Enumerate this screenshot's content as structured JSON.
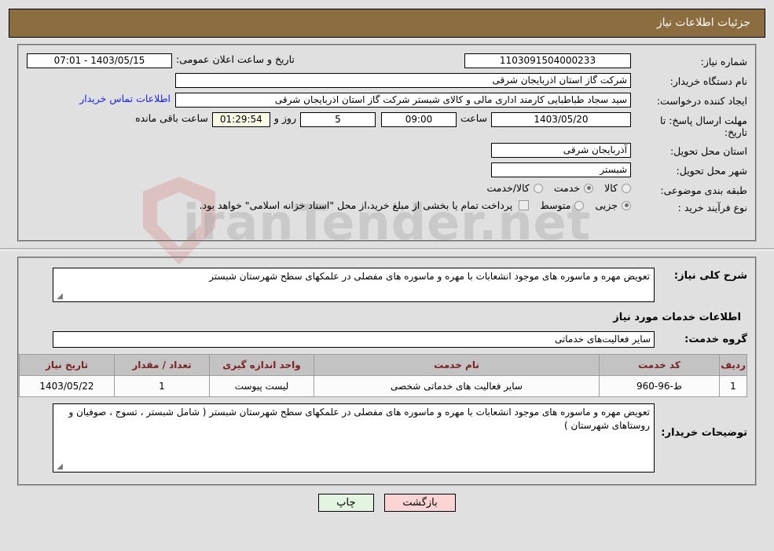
{
  "header": {
    "title": "جزئیات اطلاعات نیاز"
  },
  "form": {
    "need_number_label": "شماره نیاز:",
    "need_number_value": "1103091504000233",
    "announce_label": "تاریخ و ساعت اعلان عمومی:",
    "announce_value": "1403/05/15 - 07:01",
    "buyer_org_label": "نام دستگاه خریدار:",
    "buyer_org_value": "شرکت گاز استان اذربایجان شرقی",
    "requester_label": "ایجاد کننده درخواست:",
    "requester_value": "سید سجاد  طباطبایی کارمند اداری مالی و کالای شبستر  شرکت گاز استان اذربایجان شرقی",
    "contact_link": "اطلاعات تماس خریدار",
    "deadline_label": "مهلت ارسال پاسخ: تا تاریخ:",
    "deadline_date": "1403/05/20",
    "deadline_time_caption": "ساعت",
    "deadline_time": "09:00",
    "remaining_days": "5",
    "remaining_days_caption": "روز و",
    "remaining_time": "01:29:54",
    "remaining_time_caption": "ساعت باقی مانده",
    "province_label": "استان محل تحویل:",
    "province_value": "آذربایجان شرقی",
    "city_label": "شهر محل تحویل:",
    "city_value": "شبستر",
    "category_label": "طبقه بندی موضوعی:",
    "category_options": [
      {
        "label": "کالا",
        "selected": false
      },
      {
        "label": "خدمت",
        "selected": true
      },
      {
        "label": "کالا/خدمت",
        "selected": false
      }
    ],
    "process_label": "نوع فرآیند خرید :",
    "process_options": [
      {
        "label": "جزیی",
        "selected": true
      },
      {
        "label": "متوسط",
        "selected": false
      }
    ],
    "treasury_checkbox_checked": false,
    "treasury_note": "پرداخت تمام یا بخشی از مبلغ خرید،از محل \"اسناد خزانه اسلامی\" خواهد بود."
  },
  "lower": {
    "overall_desc_label": "شرح کلی نیاز:",
    "overall_desc_value": "تعویض مهره و ماسوره های موجود انشعابات با مهره و ماسوره های مفصلی در علمکهای سطح شهرستان شبستر",
    "services_section_title": "اطلاعات خدمات مورد نیاز",
    "service_group_label": "گروه خدمت:",
    "service_group_value": "سایر فعالیت‌های خدماتی",
    "buyer_notes_label": "توضیحات خریدار:",
    "buyer_notes_value": "تعویض مهره و ماسوره های موجود انشعابات با مهره و ماسوره های مفصلی در علمکهای سطح شهرستان شبستر ( شامل شبستر ، تسوج ، صوفیان و روستاهای شهرستان )"
  },
  "table": {
    "columns": [
      "ردیف",
      "کد خدمت",
      "نام خدمت",
      "واحد اندازه گیری",
      "تعداد / مقدار",
      "تاریخ نیاز"
    ],
    "rows": [
      {
        "radif": "1",
        "code": "ط-96-960",
        "name": "سایر فعالیت های خدماتی شخصی",
        "unit": "لیست پیوست",
        "qty": "1",
        "date": "1403/05/22"
      }
    ]
  },
  "buttons": {
    "print": "چاپ",
    "back": "بازگشت"
  },
  "watermark": {
    "text": "iranTender.net"
  },
  "colors": {
    "header_bg": "#8c6d3f",
    "link": "#1a21f0",
    "table_header_text": "#7b1f1f",
    "btn_back_bg": "#fbd4d4",
    "btn_print_bg": "#e3f5e1"
  }
}
